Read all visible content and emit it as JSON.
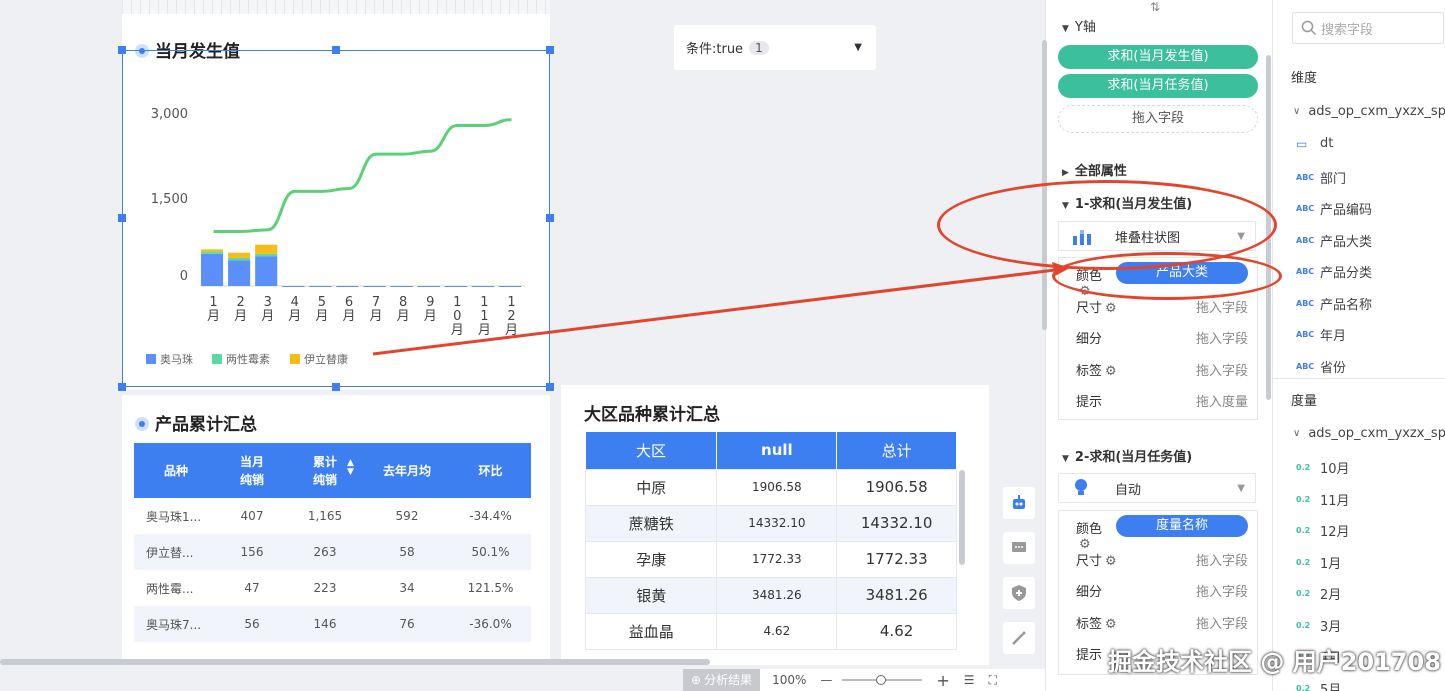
{
  "chart1": {
    "title": "当月发生值",
    "legend": [
      {
        "name": "奥马珠",
        "color": "#5b8ff9"
      },
      {
        "name": "两性霉素",
        "color": "#5ad8a6"
      },
      {
        "name": "伊立替康",
        "color": "#f6bd16"
      }
    ],
    "line_color": "#5ad176"
  },
  "chart_data": {
    "type": "bar",
    "title": "当月发生值",
    "categories": [
      "1月",
      "2月",
      "3月",
      "4月",
      "5月",
      "6月",
      "7月",
      "8月",
      "9月",
      "10月",
      "11月",
      "12月"
    ],
    "yticks": [
      "3,000",
      "1,500",
      "0"
    ],
    "ylim": [
      0,
      3400
    ],
    "series": [
      {
        "name": "奥马珠",
        "type": "bar",
        "values": [
          560,
          450,
          520,
          0,
          0,
          0,
          0,
          0,
          0,
          0,
          0,
          0
        ]
      },
      {
        "name": "两性霉素",
        "type": "bar",
        "values": [
          40,
          40,
          40,
          0,
          0,
          0,
          0,
          0,
          0,
          0,
          0,
          0
        ]
      },
      {
        "name": "伊立替康",
        "type": "bar",
        "values": [
          40,
          90,
          160,
          0,
          0,
          0,
          0,
          0,
          0,
          0,
          0,
          0
        ]
      },
      {
        "type": "line",
        "values": [
          950,
          950,
          980,
          1650,
          1650,
          1700,
          2300,
          2300,
          2350,
          2800,
          2800,
          2900
        ]
      }
    ],
    "legend_position": "bottom-left"
  },
  "condition": {
    "label": "条件:true",
    "count": "1"
  },
  "table1": {
    "title": "产品累计汇总",
    "headers": [
      [
        "品种"
      ],
      [
        "当月",
        "纯销"
      ],
      [
        "累计",
        "纯销"
      ],
      [
        "去年月均"
      ],
      [
        "环比"
      ]
    ],
    "rows": [
      [
        "奥马珠1...",
        "407",
        "1,165",
        "592",
        "-34.4%"
      ],
      [
        "伊立替...",
        "156",
        "263",
        "58",
        "50.1%"
      ],
      [
        "两性霉...",
        "47",
        "223",
        "34",
        "121.5%"
      ],
      [
        "奥马珠7...",
        "56",
        "146",
        "76",
        "-36.0%"
      ]
    ]
  },
  "table2": {
    "title": "大区品种累计汇总",
    "headers": [
      "大区",
      "null",
      "总计"
    ],
    "rows": [
      [
        "中原",
        "1906.58",
        "1906.58"
      ],
      [
        "蔗糖铁",
        "14332.10",
        "14332.10"
      ],
      [
        "孕康",
        "1772.33",
        "1772.33"
      ],
      [
        "银黄",
        "3481.26",
        "3481.26"
      ],
      [
        "益血晶",
        "4.62",
        "4.62"
      ]
    ]
  },
  "bottombar": {
    "analysis": "分析结果",
    "zoom": "100%",
    "minus": "—",
    "plus": "+"
  },
  "config": {
    "y_axis_label": "Y轴",
    "y_fields": [
      "求和(当月发生值)",
      "求和(当月任务值)"
    ],
    "drop_field": "拖入字段",
    "all_props": "全部属性",
    "section1": {
      "title": "1-求和(当月发生值)",
      "chart_type": "堆叠柱状图",
      "rows": [
        {
          "label": "颜色",
          "value": "产品大类"
        },
        {
          "label": "尺寸",
          "value": "拖入字段"
        },
        {
          "label": "细分",
          "value": "拖入字段"
        },
        {
          "label": "标签",
          "value": "拖入字段"
        },
        {
          "label": "提示",
          "value": "拖入度量"
        }
      ]
    },
    "section2": {
      "title": "2-求和(当月任务值)",
      "chart_type": "自动",
      "rows": [
        {
          "label": "颜色",
          "value": "度量名称"
        },
        {
          "label": "尺寸",
          "value": "拖入字段"
        },
        {
          "label": "细分",
          "value": "拖入字段"
        },
        {
          "label": "标签",
          "value": "拖入字段"
        },
        {
          "label": "提示",
          "value": ""
        }
      ]
    }
  },
  "fields": {
    "search_placeholder": "搜索字段",
    "dimension_label": "维度",
    "dimension_table": "ads_op_cxm_yxzx_sp",
    "dimensions": [
      {
        "type": "date",
        "name": "dt"
      },
      {
        "type": "ABC",
        "name": "部门"
      },
      {
        "type": "ABC",
        "name": "产品编码"
      },
      {
        "type": "ABC",
        "name": "产品大类"
      },
      {
        "type": "ABC",
        "name": "产品分类"
      },
      {
        "type": "ABC",
        "name": "产品名称"
      },
      {
        "type": "ABC",
        "name": "年月"
      },
      {
        "type": "ABC",
        "name": "省份"
      }
    ],
    "measure_label": "度量",
    "measure_table": "ads_op_cxm_yxzx_sp",
    "measures": [
      {
        "type": "0.2",
        "name": "10月"
      },
      {
        "type": "0.2",
        "name": "11月"
      },
      {
        "type": "0.2",
        "name": "12月"
      },
      {
        "type": "0.2",
        "name": "1月"
      },
      {
        "type": "0.2",
        "name": "2月"
      },
      {
        "type": "0.2",
        "name": "3月"
      },
      {
        "type": "0.2",
        "name": "4月"
      },
      {
        "type": "0.2",
        "name": "5月"
      }
    ]
  },
  "watermark": "掘金技术社区 @ 用户201708",
  "annotation_color": "#e2452b"
}
